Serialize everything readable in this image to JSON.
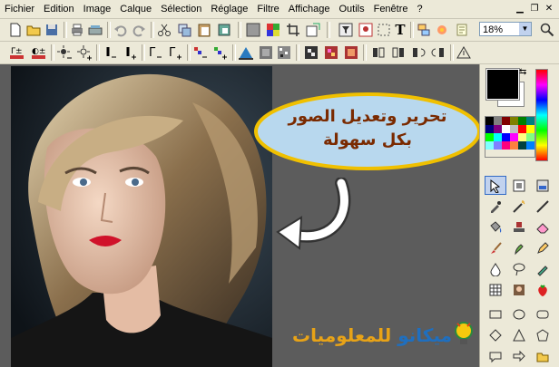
{
  "menu": {
    "items": [
      "Fichier",
      "Edition",
      "Image",
      "Calque",
      "Sélection",
      "Réglage",
      "Filtre",
      "Affichage",
      "Outils",
      "Fenêtre",
      "?"
    ]
  },
  "toolbar": {
    "zoom_value": "18%",
    "text_tool_glyph": "T"
  },
  "overlay": {
    "callout_line1": "تحرير وتعديل الصور",
    "callout_line2": "بكل سهولة",
    "logo_part1": "ميكانو",
    "logo_part2": "للمعلوميات"
  },
  "colors": {
    "callout_fill": "#b8d8ee",
    "callout_border": "#f0c000",
    "callout_text": "#7a2a00",
    "canvas_bg": "#5c5c5c",
    "foreground": "#000000",
    "background": "#ffffff"
  },
  "palette": [
    "#000000",
    "#808080",
    "#800000",
    "#808000",
    "#008000",
    "#008080",
    "#000080",
    "#800080",
    "#ffffff",
    "#c0c0c0",
    "#ff0000",
    "#ffff00",
    "#00ff00",
    "#00ffff",
    "#0000ff",
    "#ff00ff",
    "#ffff80",
    "#80ff80",
    "#80ffff",
    "#8080ff",
    "#ff0080",
    "#ff8040",
    "#004040",
    "#0080ff"
  ],
  "tools": [
    "arrow-select-icon",
    "layer-move-icon",
    "fill-icon",
    "eyedropper-icon",
    "magic-wand-icon",
    "line-icon",
    "bucket-icon",
    "stamp-icon",
    "eraser-icon",
    "brush-icon",
    "smudge-icon",
    "pen-icon",
    "drop-icon",
    "lasso-icon",
    "blur-icon",
    "grid-icon",
    "portrait-icon",
    "strawberry-icon"
  ],
  "shape_tools": [
    "rectangle-icon",
    "ellipse-icon",
    "rounded-rect-icon",
    "diamond-icon",
    "triangle-icon",
    "polygon-icon",
    "speech-bubble-icon",
    "arrow-shape-icon",
    "folder-icon"
  ]
}
